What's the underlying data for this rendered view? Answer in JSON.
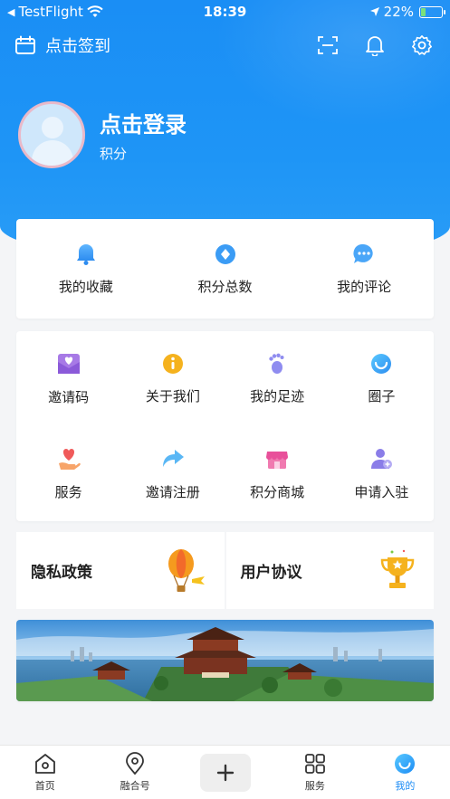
{
  "status_bar": {
    "carrier": "TestFlight",
    "time": "18:39",
    "battery_percent": "22%",
    "battery_level": 0.22
  },
  "header": {
    "checkin_label": "点击签到",
    "icons": [
      "calendar-icon",
      "scan-icon",
      "bell-icon",
      "gear-icon"
    ]
  },
  "profile": {
    "login_label": "点击登录",
    "points_label": "积分"
  },
  "stats": [
    {
      "label": "我的收藏",
      "icon": "bell-icon"
    },
    {
      "label": "积分总数",
      "icon": "diamond-coin-icon"
    },
    {
      "label": "我的评论",
      "icon": "chat-bubble-icon"
    }
  ],
  "grid": [
    {
      "label": "邀请码",
      "icon": "mail-heart-icon"
    },
    {
      "label": "关于我们",
      "icon": "info-icon"
    },
    {
      "label": "我的足迹",
      "icon": "footprint-icon"
    },
    {
      "label": "圈子",
      "icon": "circle-icon"
    },
    {
      "label": "服务",
      "icon": "heart-hand-icon"
    },
    {
      "label": "邀请注册",
      "icon": "share-arrow-icon"
    },
    {
      "label": "积分商城",
      "icon": "store-icon"
    },
    {
      "label": "申请入驻",
      "icon": "user-add-icon"
    }
  ],
  "policies": [
    {
      "label": "隐私政策",
      "icon": "balloon-icon"
    },
    {
      "label": "用户协议",
      "icon": "trophy-icon"
    }
  ],
  "tabs": [
    {
      "label": "首页",
      "icon": "home-icon"
    },
    {
      "label": "融合号",
      "icon": "location-pin-icon"
    },
    {
      "label": "",
      "icon": "plus-icon"
    },
    {
      "label": "服务",
      "icon": "grid-icon"
    },
    {
      "label": "我的",
      "icon": "profile-circle-icon",
      "active": true
    }
  ],
  "colors": {
    "accent": "#1c8cf5",
    "hero": "#1a8ef5"
  }
}
